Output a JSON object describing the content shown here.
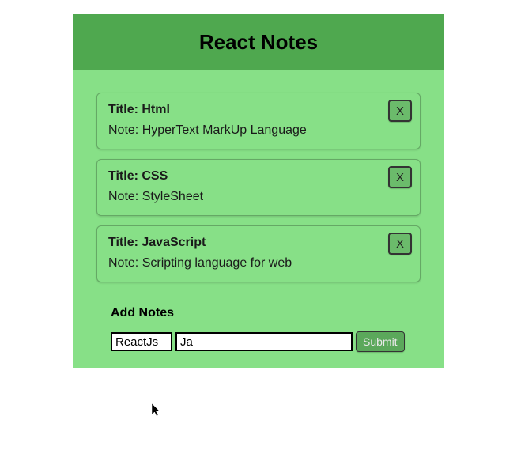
{
  "header": {
    "title": "React Notes"
  },
  "notes": [
    {
      "title_label": "Title: Html",
      "note_label": "Note: HyperText MarkUp Language",
      "delete_label": "X"
    },
    {
      "title_label": "Title: CSS",
      "note_label": "Note: StyleSheet",
      "delete_label": "X"
    },
    {
      "title_label": "Title: JavaScript",
      "note_label": "Note: Scripting language for web",
      "delete_label": "X"
    }
  ],
  "form": {
    "section_label": "Add Notes",
    "title_value": "ReactJs",
    "note_value": "Ja",
    "submit_label": "Submit"
  }
}
